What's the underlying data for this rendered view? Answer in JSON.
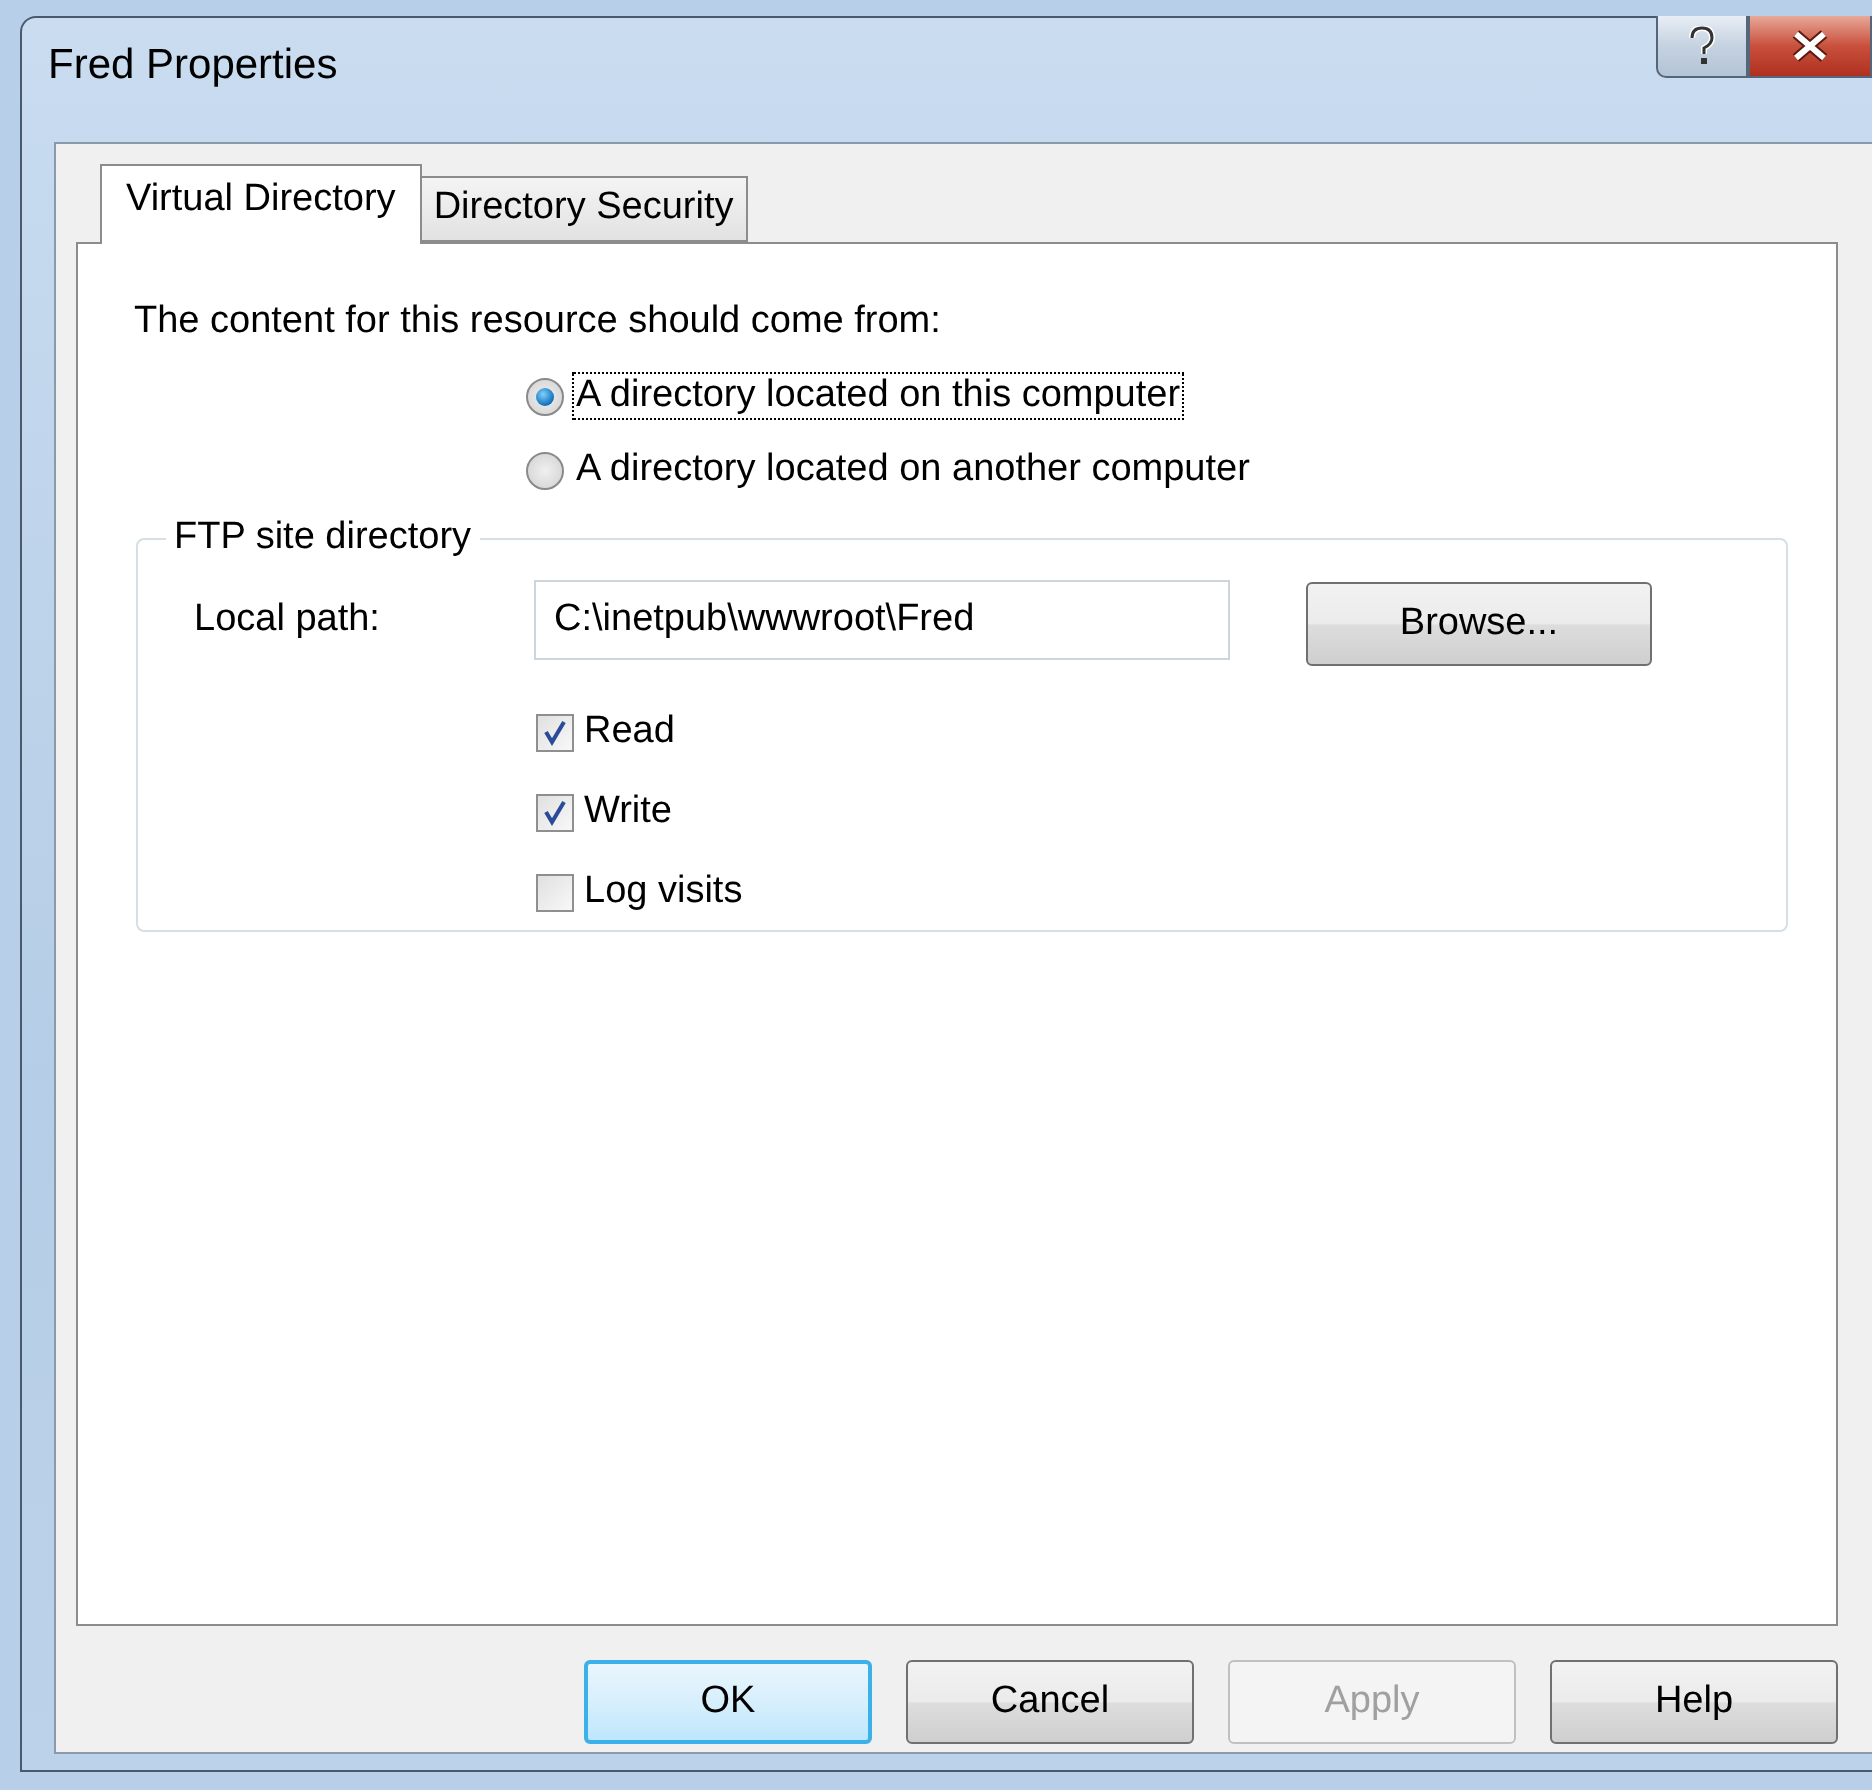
{
  "window": {
    "title": "Fred Properties"
  },
  "tabs": [
    {
      "label": "Virtual Directory",
      "selected": true
    },
    {
      "label": "Directory Security",
      "selected": false
    }
  ],
  "prompt": "The content for this resource should come from:",
  "source_options": [
    {
      "label": "A directory located on this computer",
      "selected": true,
      "focused": true
    },
    {
      "label": "A directory located on another computer",
      "selected": false,
      "focused": false
    }
  ],
  "ftp_group": {
    "legend": "FTP site directory",
    "local_path_label": "Local path:",
    "local_path": "C:\\inetpub\\wwwroot\\Fred",
    "browse_button": "Browse...",
    "permissions": [
      {
        "label": "Read",
        "checked": true
      },
      {
        "label": "Write",
        "checked": true
      },
      {
        "label": "Log visits",
        "checked": false
      }
    ]
  },
  "buttons": [
    {
      "label": "OK",
      "default": true,
      "disabled": false
    },
    {
      "label": "Cancel",
      "default": false,
      "disabled": false
    },
    {
      "label": "Apply",
      "default": false,
      "disabled": true
    },
    {
      "label": "Help",
      "default": false,
      "disabled": false
    }
  ]
}
